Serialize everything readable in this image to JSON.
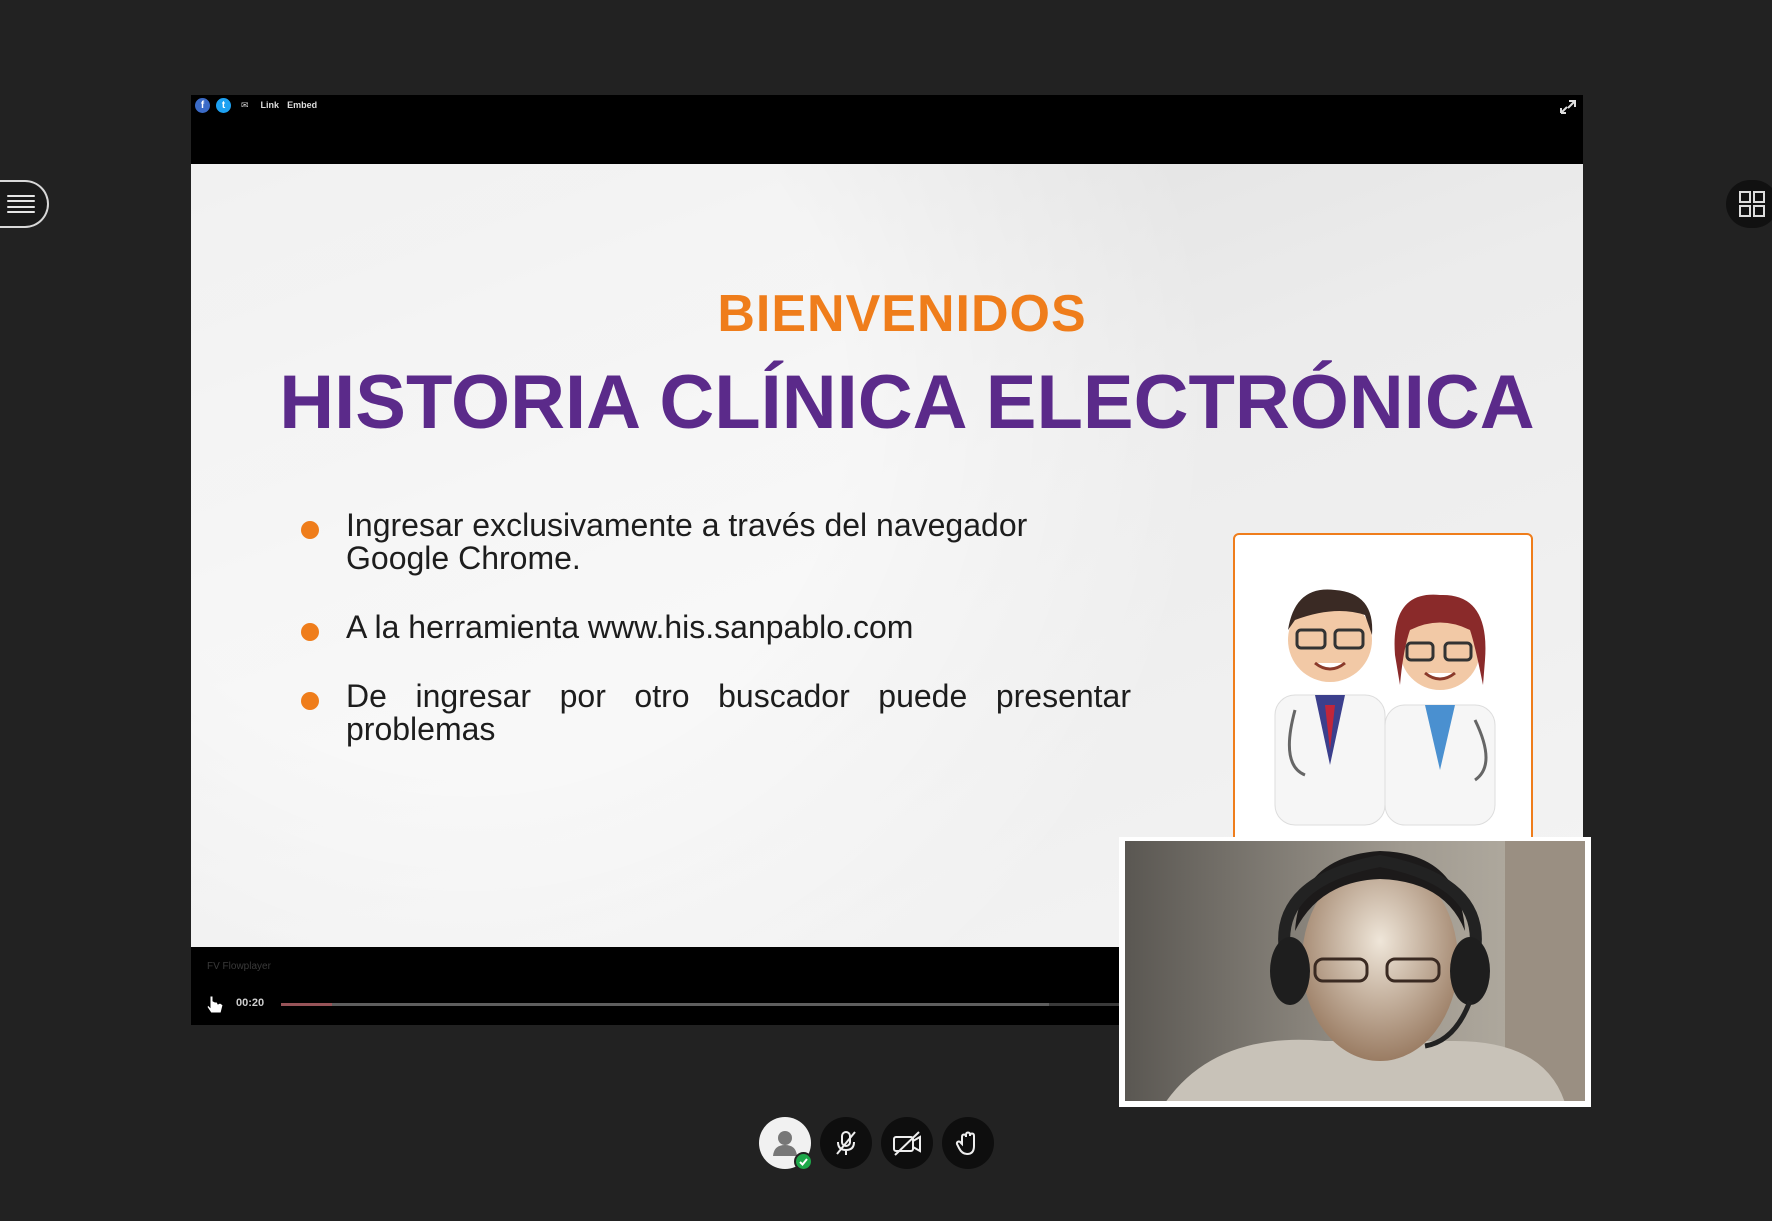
{
  "share_bar": {
    "link_label": "Link",
    "embed_label": "Embed"
  },
  "slide": {
    "greeting": "BIENVENIDOS",
    "title": "HISTORIA CLÍNICA ELECTRÓNICA",
    "bullets": [
      "Ingresar exclusivamente a través del navegador Google Chrome.",
      "A la herramienta www.his.sanpablo.com",
      "De ingresar por otro buscador puede presentar problemas"
    ],
    "accent_color": "#ef7d1b",
    "title_color": "#5b2a8a"
  },
  "player": {
    "brand": "FV Flowplayer",
    "time": "00:20",
    "progress": 0.04
  },
  "toolbar": {
    "icons": [
      "avatar-icon",
      "mic-muted-icon",
      "camera-off-icon",
      "raise-hand-icon"
    ],
    "status_color": "#1ea84a"
  }
}
